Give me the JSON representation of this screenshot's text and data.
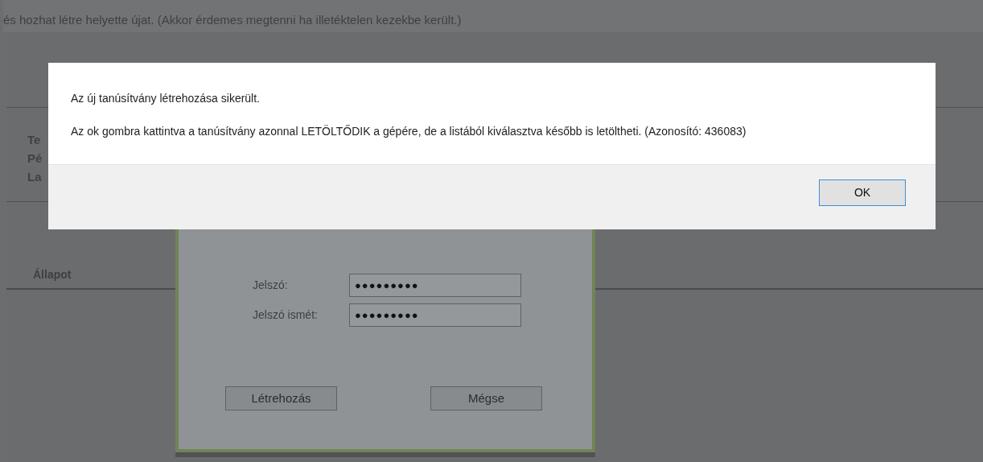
{
  "page": {
    "notice": "és hozhat létre helyette újat. (Akkor érdemes megtenni ha illetéktelen kezekbe került.)",
    "details": [
      "Te",
      "Pé",
      "La"
    ],
    "column_header": "Állapot"
  },
  "password_dialog": {
    "fields": [
      {
        "label": "Jelszó:",
        "value": "●●●●●●●●●"
      },
      {
        "label": "Jelszó ismét:",
        "value": "●●●●●●●●●"
      }
    ],
    "buttons": [
      "Létrehozás",
      "Mégse"
    ]
  },
  "alert": {
    "messages": [
      "Az új tanúsítvány létrehozása sikerült.",
      "Az ok gombra kattintva a tanúsítvány azonnal LETÖLTŐDIK a gépére, de a listából kiválasztva később is letöltheti. (Azonosító: 436083)"
    ],
    "button": "OK"
  }
}
